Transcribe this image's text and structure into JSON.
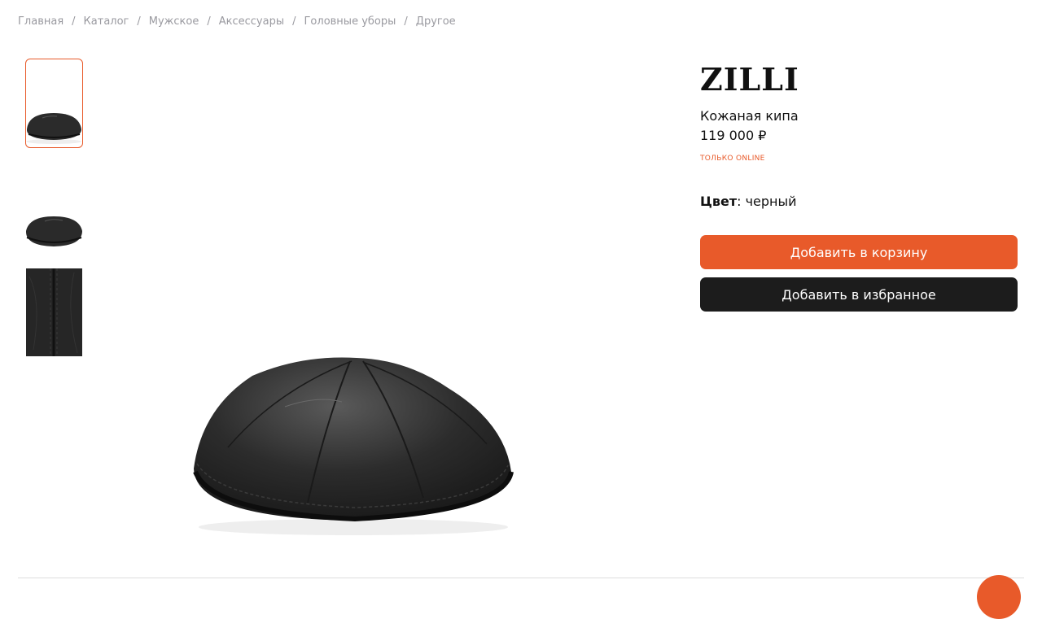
{
  "breadcrumbs": [
    {
      "label": "Главная"
    },
    {
      "label": "Каталог"
    },
    {
      "label": "Мужское"
    },
    {
      "label": "Аксессуары"
    },
    {
      "label": "Головные уборы"
    },
    {
      "label": "Другое"
    }
  ],
  "breadcrumb_separator": "/",
  "product": {
    "brand": "ZILLI",
    "name": "Кожаная кипа",
    "price": "119 000 ₽",
    "badge": "ТОЛЬКО ONLINE",
    "color_label": "Цвет",
    "color_value": "черный"
  },
  "actions": {
    "add_to_cart": "Добавить в корзину",
    "add_to_favorites": "Добавить в избранное"
  },
  "gallery": {
    "selected_index": 0,
    "thumbnails": [
      "kippah-front",
      "kippah-side",
      "kippah-detail"
    ]
  },
  "colors": {
    "accent": "#e85a2a",
    "dark_button": "#1c1c1c",
    "breadcrumb": "#9a9aa0"
  }
}
